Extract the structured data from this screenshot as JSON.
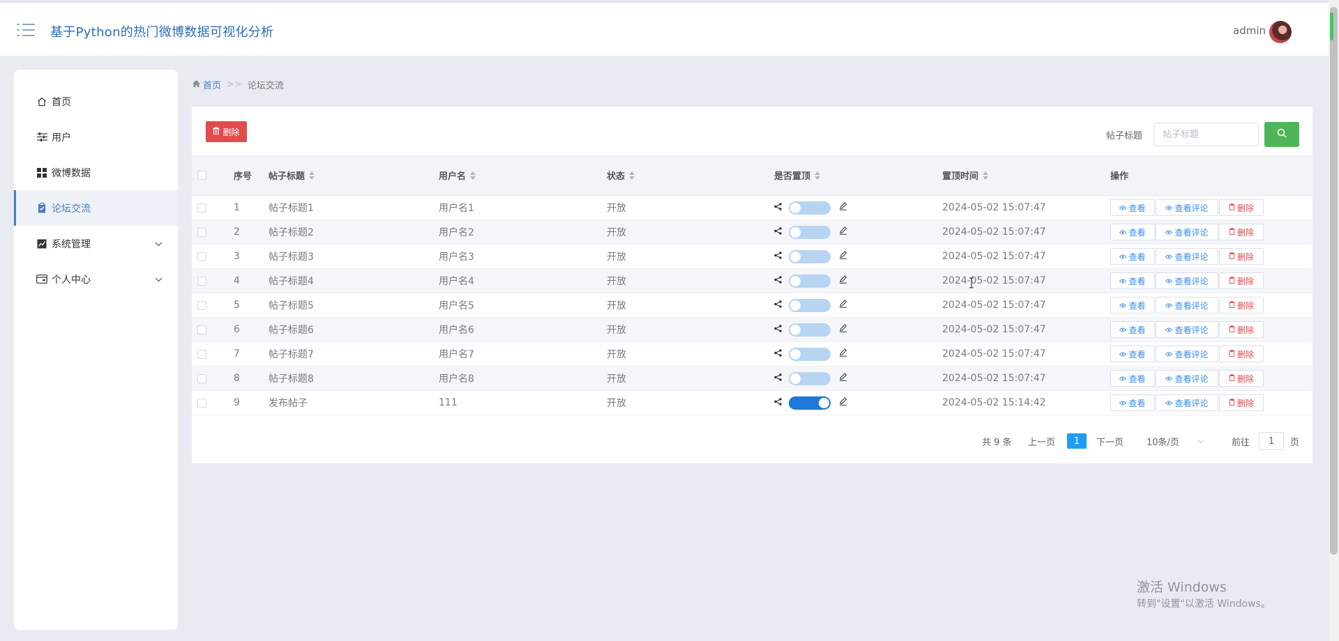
{
  "header": {
    "title": "基于Python的热门微博数据可视化分析",
    "user": "admin"
  },
  "sidebar": {
    "items": [
      {
        "label": "首页",
        "icon": "home-icon"
      },
      {
        "label": "用户",
        "icon": "sliders-icon"
      },
      {
        "label": "微博数据",
        "icon": "grid-icon"
      },
      {
        "label": "论坛交流",
        "icon": "clipboard-icon",
        "active": true
      },
      {
        "label": "系统管理",
        "icon": "chart-icon",
        "expandable": true
      },
      {
        "label": "个人中心",
        "icon": "card-icon",
        "expandable": true
      }
    ]
  },
  "breadcrumb": {
    "home": "首页",
    "separator": ">>",
    "current": "论坛交流"
  },
  "toolbar": {
    "delete_label": "删除",
    "search_label": "帖子标题",
    "search_placeholder": "帖子标题"
  },
  "table": {
    "headers": {
      "index": "序号",
      "title": "帖子标题",
      "username": "用户名",
      "status": "状态",
      "pinned": "是否置顶",
      "pin_time": "置顶时间",
      "actions": "操作"
    },
    "action_labels": {
      "view": "查看",
      "view_comments": "查看评论",
      "delete": "删除"
    },
    "rows": [
      {
        "index": "1",
        "title": "帖子标题1",
        "username": "用户名1",
        "status": "开放",
        "pinned": false,
        "pin_time": "2024-05-02 15:07:47"
      },
      {
        "index": "2",
        "title": "帖子标题2",
        "username": "用户名2",
        "status": "开放",
        "pinned": false,
        "pin_time": "2024-05-02 15:07:47"
      },
      {
        "index": "3",
        "title": "帖子标题3",
        "username": "用户名3",
        "status": "开放",
        "pinned": false,
        "pin_time": "2024-05-02 15:07:47"
      },
      {
        "index": "4",
        "title": "帖子标题4",
        "username": "用户名4",
        "status": "开放",
        "pinned": false,
        "pin_time": "2024-05-02 15:07:47"
      },
      {
        "index": "5",
        "title": "帖子标题5",
        "username": "用户名5",
        "status": "开放",
        "pinned": false,
        "pin_time": "2024-05-02 15:07:47"
      },
      {
        "index": "6",
        "title": "帖子标题6",
        "username": "用户名6",
        "status": "开放",
        "pinned": false,
        "pin_time": "2024-05-02 15:07:47"
      },
      {
        "index": "7",
        "title": "帖子标题7",
        "username": "用户名7",
        "status": "开放",
        "pinned": false,
        "pin_time": "2024-05-02 15:07:47"
      },
      {
        "index": "8",
        "title": "帖子标题8",
        "username": "用户名8",
        "status": "开放",
        "pinned": false,
        "pin_time": "2024-05-02 15:07:47"
      },
      {
        "index": "9",
        "title": "发布帖子",
        "username": "111",
        "status": "开放",
        "pinned": true,
        "pin_time": "2024-05-02 15:14:42"
      }
    ]
  },
  "pagination": {
    "total": "共 9 条",
    "prev": "上一页",
    "current_page": "1",
    "next": "下一页",
    "page_size": "10条/页",
    "goto_label": "前往",
    "goto_value": "1",
    "page_suffix": "页"
  },
  "watermark": {
    "line1": "激活 Windows",
    "line2": "转到\"设置\"以激活 Windows。"
  },
  "colors": {
    "accent": "#4a7ec0",
    "delete": "#e04c4c",
    "search": "#4fb55b",
    "toggle_on": "#1d78d8",
    "toggle_off": "#b7d5f2",
    "page_current": "#1f9df1"
  }
}
